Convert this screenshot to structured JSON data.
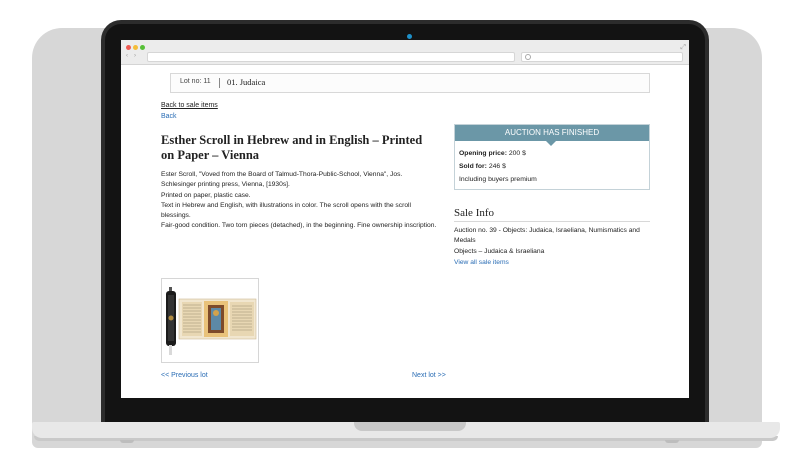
{
  "lot": {
    "number_label": "Lot no: 11",
    "category": "01. Judaica"
  },
  "nav": {
    "back_to_sale": "Back to sale items",
    "back": "Back",
    "prev_lot": "<< Previous lot",
    "next_lot": "Next lot >>"
  },
  "item": {
    "title": "Esther Scroll in Hebrew and in English – Printed on Paper – Vienna",
    "description_lines": [
      "Ester Scroll, \"Voved from the Board of Talmud-Thora-Public-School, Vienna\", Jos. Schlesinger printing press, Vienna, [1930s].",
      "Printed on paper, plastic case.",
      "Text in Hebrew and English, with illustrations in color. The scroll opens with the scroll blessings.",
      "Fair-good condition. Two torn pieces (detached), in the beginning. Fine ownership inscription."
    ]
  },
  "auction": {
    "status": "AUCTION HAS FINISHED",
    "opening_label": "Opening price:",
    "opening_value": "200 $",
    "sold_label": "Sold for:",
    "sold_value": "246 $",
    "premium_note": "Including buyers premium",
    "header_color": "#6b97a7"
  },
  "sale_info": {
    "heading": "Sale Info",
    "lines": [
      "Auction no. 39 - Objects: Judaica, Israeliana, Numismatics and Medals",
      "Objects – Judaica & Israeliana"
    ],
    "view_all": "View all sale items"
  },
  "browser": {
    "back_icon": "‹",
    "forward_icon": "›"
  },
  "colors": {
    "link": "#2a6db5",
    "laptop_frame": "#2c2c2c",
    "camera": "#1e90c9"
  }
}
